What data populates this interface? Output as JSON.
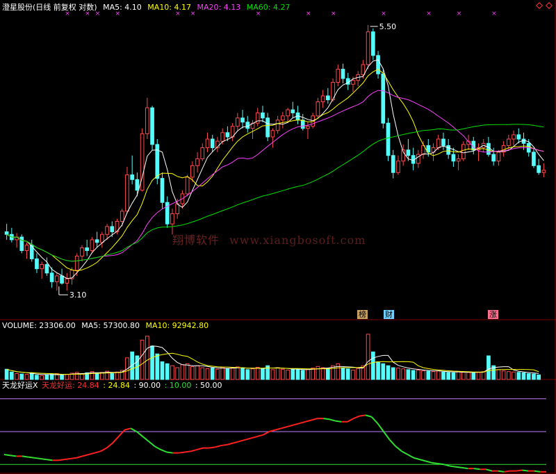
{
  "main_panel": {
    "title": "澄星股份(日线 前复权 对数)",
    "ma5_label": "MA5: 4.10",
    "ma10_label": "MA10: 4.17",
    "ma20_label": "MA20: 4.13",
    "ma60_label": "MA60: 4.27",
    "high_annotation": "5.50",
    "low_annotation": "3.10",
    "event_tags": [
      "榜",
      "财",
      "涨"
    ],
    "watermark_cn": "翔博软件",
    "watermark_url": "www.xiangbosoft.com",
    "corner_icon": "diamond-icons"
  },
  "volume_panel": {
    "title": "VOLUME: 23306.00",
    "ma5_label": "MA5: 57300.80",
    "ma10_label": "MA10: 92942.80"
  },
  "indicator_panel": {
    "name": "天龙好运X",
    "line_label": "天龙好运: 24.84",
    "value_label": ": 24.84",
    "level1": ": 90.00",
    "level2": ": 10.00",
    "level3": ": 50.00"
  },
  "colors": {
    "up": "#ff4a4a",
    "down": "#54fcfc",
    "ma5": "#ffffff",
    "ma10": "#ffff00",
    "ma20": "#ff40ff",
    "ma60": "#00e000",
    "ind_up": "#ff2020",
    "ind_down": "#30e030",
    "grid": "#800000"
  },
  "chart_data": {
    "type": "candlestick",
    "price_scale": "log",
    "price_range": [
      3.0,
      5.6
    ],
    "highest": 5.5,
    "lowest": 3.1,
    "candles": [
      [
        3.52,
        3.58,
        3.46,
        3.5
      ],
      [
        3.5,
        3.55,
        3.44,
        3.46
      ],
      [
        3.46,
        3.51,
        3.4,
        3.48
      ],
      [
        3.48,
        3.5,
        3.36,
        3.38
      ],
      [
        3.38,
        3.44,
        3.32,
        3.42
      ],
      [
        3.42,
        3.46,
        3.3,
        3.32
      ],
      [
        3.32,
        3.36,
        3.22,
        3.25
      ],
      [
        3.25,
        3.3,
        3.18,
        3.28
      ],
      [
        3.28,
        3.33,
        3.2,
        3.22
      ],
      [
        3.22,
        3.26,
        3.12,
        3.16
      ],
      [
        3.16,
        3.22,
        3.1,
        3.2
      ],
      [
        3.2,
        3.25,
        3.14,
        3.15
      ],
      [
        3.15,
        3.22,
        3.1,
        3.18
      ],
      [
        3.18,
        3.26,
        3.14,
        3.24
      ],
      [
        3.24,
        3.36,
        3.2,
        3.34
      ],
      [
        3.34,
        3.42,
        3.3,
        3.4
      ],
      [
        3.4,
        3.46,
        3.34,
        3.38
      ],
      [
        3.38,
        3.48,
        3.36,
        3.46
      ],
      [
        3.46,
        3.52,
        3.4,
        3.44
      ],
      [
        3.44,
        3.52,
        3.4,
        3.5
      ],
      [
        3.5,
        3.58,
        3.46,
        3.56
      ],
      [
        3.56,
        3.6,
        3.48,
        3.52
      ],
      [
        3.52,
        3.62,
        3.5,
        3.6
      ],
      [
        3.6,
        3.7,
        3.56,
        3.68
      ],
      [
        3.68,
        4.05,
        3.66,
        3.98
      ],
      [
        3.98,
        4.15,
        3.9,
        3.94
      ],
      [
        3.94,
        4.0,
        3.8,
        3.85
      ],
      [
        3.85,
        4.4,
        3.84,
        4.35
      ],
      [
        4.35,
        4.7,
        4.3,
        4.6
      ],
      [
        4.6,
        4.62,
        4.2,
        4.25
      ],
      [
        4.25,
        4.3,
        3.9,
        3.95
      ],
      [
        3.95,
        4.0,
        3.7,
        3.75
      ],
      [
        3.75,
        3.8,
        3.55,
        3.58
      ],
      [
        3.58,
        3.7,
        3.5,
        3.66
      ],
      [
        3.66,
        3.78,
        3.62,
        3.74
      ],
      [
        3.74,
        3.85,
        3.7,
        3.82
      ],
      [
        3.82,
        3.98,
        3.8,
        3.96
      ],
      [
        3.96,
        4.1,
        3.92,
        4.06
      ],
      [
        4.06,
        4.18,
        4.0,
        4.12
      ],
      [
        4.12,
        4.26,
        4.1,
        4.22
      ],
      [
        4.22,
        4.36,
        4.18,
        4.3
      ],
      [
        4.3,
        4.34,
        4.18,
        4.22
      ],
      [
        4.22,
        4.32,
        4.18,
        4.28
      ],
      [
        4.28,
        4.4,
        4.25,
        4.36
      ],
      [
        4.36,
        4.42,
        4.28,
        4.32
      ],
      [
        4.32,
        4.45,
        4.28,
        4.42
      ],
      [
        4.42,
        4.55,
        4.38,
        4.5
      ],
      [
        4.5,
        4.58,
        4.4,
        4.46
      ],
      [
        4.46,
        4.52,
        4.36,
        4.4
      ],
      [
        4.4,
        4.48,
        4.3,
        4.45
      ],
      [
        4.45,
        4.6,
        4.42,
        4.55
      ],
      [
        4.55,
        4.62,
        4.46,
        4.5
      ],
      [
        4.5,
        4.55,
        4.28,
        4.32
      ],
      [
        4.32,
        4.4,
        4.22,
        4.38
      ],
      [
        4.38,
        4.52,
        4.35,
        4.48
      ],
      [
        4.48,
        4.56,
        4.4,
        4.52
      ],
      [
        4.52,
        4.6,
        4.46,
        4.58
      ],
      [
        4.58,
        4.66,
        4.5,
        4.55
      ],
      [
        4.55,
        4.62,
        4.44,
        4.48
      ],
      [
        4.48,
        4.54,
        4.38,
        4.4
      ],
      [
        4.4,
        4.46,
        4.3,
        4.42
      ],
      [
        4.42,
        4.55,
        4.4,
        4.52
      ],
      [
        4.52,
        4.7,
        4.5,
        4.66
      ],
      [
        4.66,
        4.78,
        4.6,
        4.72
      ],
      [
        4.72,
        4.8,
        4.64,
        4.68
      ],
      [
        4.68,
        4.9,
        4.66,
        4.86
      ],
      [
        4.86,
        5.05,
        4.82,
        5.0
      ],
      [
        5.0,
        5.06,
        4.85,
        4.9
      ],
      [
        4.9,
        4.96,
        4.78,
        4.84
      ],
      [
        4.84,
        4.92,
        4.76,
        4.88
      ],
      [
        4.88,
        4.98,
        4.82,
        4.94
      ],
      [
        4.94,
        5.1,
        4.9,
        5.05
      ],
      [
        5.05,
        5.5,
        5.0,
        5.42
      ],
      [
        5.42,
        5.46,
        5.1,
        5.15
      ],
      [
        5.15,
        5.2,
        4.9,
        4.95
      ],
      [
        4.95,
        5.0,
        4.4,
        4.45
      ],
      [
        4.45,
        4.5,
        4.1,
        4.15
      ],
      [
        4.15,
        4.2,
        3.95,
        4.0
      ],
      [
        4.0,
        4.15,
        3.98,
        4.1
      ],
      [
        4.1,
        4.25,
        4.06,
        4.2
      ],
      [
        4.2,
        4.3,
        4.1,
        4.15
      ],
      [
        4.15,
        4.22,
        4.02,
        4.08
      ],
      [
        4.08,
        4.2,
        4.04,
        4.16
      ],
      [
        4.16,
        4.28,
        4.12,
        4.24
      ],
      [
        4.24,
        4.3,
        4.14,
        4.18
      ],
      [
        4.18,
        4.26,
        4.1,
        4.22
      ],
      [
        4.22,
        4.34,
        4.2,
        4.3
      ],
      [
        4.3,
        4.36,
        4.2,
        4.24
      ],
      [
        4.24,
        4.3,
        4.12,
        4.16
      ],
      [
        4.16,
        4.22,
        4.05,
        4.1
      ],
      [
        4.1,
        4.16,
        4.02,
        4.12
      ],
      [
        4.12,
        4.28,
        4.1,
        4.25
      ],
      [
        4.25,
        4.34,
        4.2,
        4.28
      ],
      [
        4.28,
        4.32,
        4.16,
        4.2
      ],
      [
        4.2,
        4.26,
        4.1,
        4.22
      ],
      [
        4.22,
        4.3,
        4.18,
        4.26
      ],
      [
        4.26,
        4.32,
        4.14,
        4.16
      ],
      [
        4.16,
        4.22,
        4.06,
        4.1
      ],
      [
        4.1,
        4.2,
        4.06,
        4.18
      ],
      [
        4.18,
        4.28,
        4.14,
        4.24
      ],
      [
        4.24,
        4.34,
        4.2,
        4.3
      ],
      [
        4.3,
        4.38,
        4.24,
        4.34
      ],
      [
        4.34,
        4.4,
        4.26,
        4.3
      ],
      [
        4.3,
        4.36,
        4.2,
        4.26
      ],
      [
        4.26,
        4.3,
        4.14,
        4.18
      ],
      [
        4.18,
        4.22,
        4.04,
        4.06
      ],
      [
        4.06,
        4.12,
        3.98,
        4.0
      ],
      [
        4.0,
        4.08,
        3.96,
        4.02
      ]
    ],
    "volume_max": 240000,
    "volume": [
      52000,
      38000,
      30000,
      28000,
      26000,
      34000,
      22000,
      20000,
      24000,
      26000,
      30000,
      24000,
      26000,
      32000,
      36000,
      30000,
      34000,
      40000,
      32000,
      36000,
      42000,
      30000,
      38000,
      46000,
      110000,
      140000,
      120000,
      200000,
      220000,
      170000,
      130000,
      90000,
      80000,
      70000,
      60000,
      75000,
      80000,
      65000,
      70000,
      60000,
      55000,
      58000,
      52000,
      62000,
      56000,
      60000,
      64000,
      58000,
      50000,
      54000,
      62000,
      56000,
      70000,
      50000,
      60000,
      52000,
      48000,
      54000,
      50000,
      46000,
      52000,
      58000,
      66000,
      60000,
      56000,
      70000,
      80000,
      60000,
      54000,
      48000,
      56000,
      70000,
      230000,
      140000,
      90000,
      80000,
      70000,
      60000,
      58000,
      54000,
      50000,
      46000,
      48000,
      44000,
      42000,
      40000,
      44000,
      38000,
      36000,
      34000,
      40000,
      38000,
      36000,
      34000,
      36000,
      40000,
      120000,
      70000,
      50000,
      44000,
      40000,
      38000,
      36000,
      34000,
      30000,
      28000,
      23306
    ],
    "indicator_range": [
      0,
      100
    ],
    "levels": [
      90,
      10,
      50
    ],
    "indicator": [
      22,
      21,
      20,
      20,
      19,
      18,
      17,
      16,
      15,
      15,
      16,
      17,
      18,
      20,
      22,
      24,
      26,
      30,
      36,
      44,
      52,
      54,
      50,
      44,
      38,
      32,
      28,
      25,
      24,
      24,
      25,
      26,
      28,
      30,
      30,
      31,
      33,
      34,
      36,
      38,
      40,
      42,
      44,
      46,
      50,
      52,
      54,
      56,
      58,
      60,
      62,
      64,
      66,
      66,
      65,
      63,
      62,
      62,
      66,
      69,
      70,
      68,
      60,
      50,
      40,
      32,
      26,
      22,
      18,
      16,
      14,
      12,
      11,
      10,
      8,
      7,
      6,
      5,
      5,
      4,
      4,
      2,
      2,
      1,
      2,
      2,
      3,
      2,
      2,
      1,
      1
    ]
  }
}
